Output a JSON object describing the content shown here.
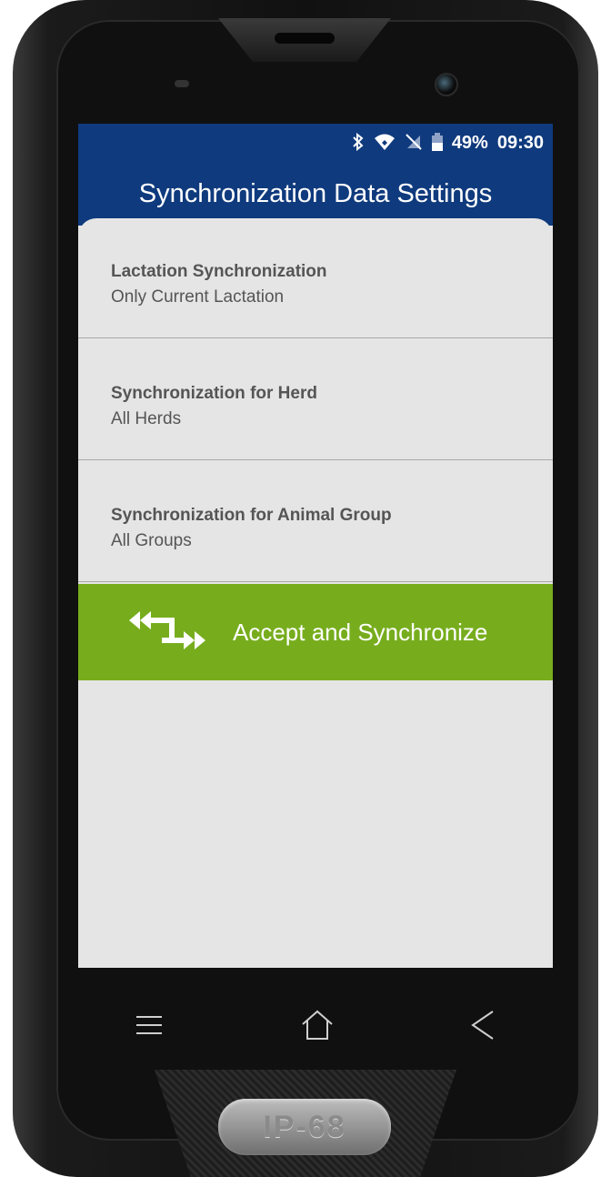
{
  "status_bar": {
    "icons": [
      "bluetooth-icon",
      "wifi-icon",
      "no-sim-icon",
      "battery-icon"
    ],
    "battery": "49%",
    "time": "09:30"
  },
  "app_bar": {
    "title": "Synchronization Data Settings"
  },
  "settings": [
    {
      "title": "Lactation Synchronization",
      "value": "Only Current Lactation"
    },
    {
      "title": "Synchronization for Herd",
      "value": "All Herds"
    },
    {
      "title": "Synchronization for Animal Group",
      "value": "All Groups"
    }
  ],
  "sync_button": {
    "label": "Accept and Synchronize",
    "icon": "sync-arrows-icon"
  },
  "nav_bar": {
    "icons": [
      "menu-icon",
      "home-icon",
      "back-icon"
    ]
  },
  "device": {
    "badge": "IP-68"
  },
  "colors": {
    "header": "#0f3a7d",
    "accent_green": "#77ad1d",
    "background": "#e5e5e5",
    "text": "#555555"
  }
}
